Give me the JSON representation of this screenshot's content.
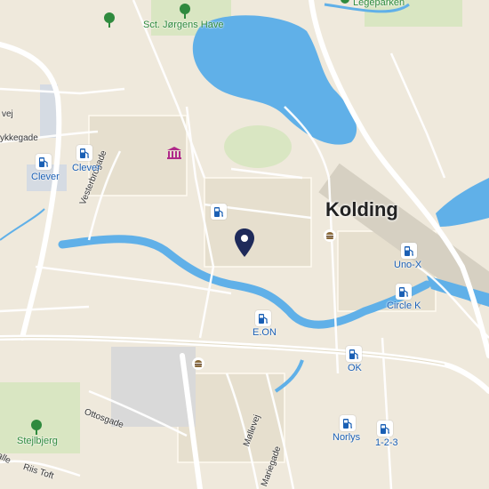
{
  "map": {
    "city_label": "Kolding",
    "colors": {
      "water": "#60b0e8",
      "land": "#efe9dc",
      "park": "#dce8c8",
      "road": "#ffffff",
      "major_road": "#fff6d8",
      "poi_blue": "#1a5fb4",
      "marker": "#1e2a5a"
    },
    "streets": [
      {
        "name": "Vesterbrogade"
      },
      {
        "name": "Ottosgade"
      },
      {
        "name": "Møllevej"
      },
      {
        "name": "Mariegade"
      },
      {
        "name": "Riis Toft"
      },
      {
        "name": "ykkegade"
      },
      {
        "name": "vej"
      },
      {
        "name": "alle"
      }
    ],
    "parks": [
      {
        "name": "Sct. Jørgens Have",
        "icon": "tree-icon"
      },
      {
        "name": "Legeparken",
        "icon": "tree-icon"
      },
      {
        "name": "Stejlbjerg",
        "icon": "tree-icon"
      }
    ],
    "fuel_stations": [
      {
        "name": "Clever",
        "icon": "fuel-station-icon"
      },
      {
        "name": "Clever",
        "icon": "fuel-station-icon"
      },
      {
        "name": "",
        "icon": "fuel-station-icon"
      },
      {
        "name": "Uno-X",
        "icon": "fuel-station-icon"
      },
      {
        "name": "Circle K",
        "icon": "fuel-station-icon"
      },
      {
        "name": "E.ON",
        "icon": "fuel-station-icon"
      },
      {
        "name": "OK",
        "icon": "fuel-station-icon"
      },
      {
        "name": "Norlys",
        "icon": "fuel-station-icon"
      },
      {
        "name": "1-2-3",
        "icon": "fuel-station-icon"
      }
    ],
    "other_icons": [
      "museum-icon",
      "burger-icon",
      "burger-icon",
      "location-pin-icon"
    ]
  }
}
